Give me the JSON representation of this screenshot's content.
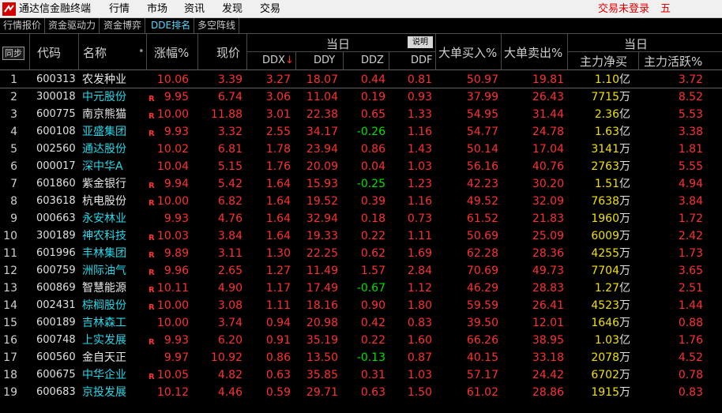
{
  "app": {
    "title": "通达信金融终端",
    "menu": [
      "行情",
      "市场",
      "资讯",
      "发现",
      "交易"
    ],
    "login_status": "交易未登录",
    "extra": "五"
  },
  "tabs": [
    {
      "label": "行情报价",
      "active": false
    },
    {
      "label": "资金驱动力",
      "active": false
    },
    {
      "label": "资金博弈",
      "active": false
    },
    {
      "label": "DDE排名",
      "active": true
    },
    {
      "label": "多空阵线",
      "active": false
    }
  ],
  "header": {
    "sync": "同步",
    "code": "代码",
    "name": "名称",
    "name_marker": "•",
    "change_pct": "涨幅%",
    "price": "现价",
    "group1": "当日",
    "explain": "说明",
    "ddx": "DDX",
    "ddx_sort": "↓",
    "ddy": "DDY",
    "ddz": "DDZ",
    "ddf": "DDF",
    "big_buy": "大单买入%",
    "big_sell": "大单卖出%",
    "group2": "当日",
    "net_buy": "主力净买",
    "active_pct": "主力活跃%"
  },
  "colors": {
    "up": "#ff3030",
    "down": "#00e000",
    "volume": "#f0e000",
    "name_cyan": "#28d7e8"
  },
  "rows": [
    {
      "idx": "1",
      "code": "600313",
      "name": "农发种业",
      "nameColor": "white",
      "r": "",
      "chg": "10.06",
      "price": "3.39",
      "ddx": "3.27",
      "ddy": "18.07",
      "ddz": "0.44",
      "ddzDir": "up",
      "ddf": "0.81",
      "buy": "50.97",
      "sell": "19.81",
      "net": "1.10",
      "netUnit": "亿",
      "active": "3.72"
    },
    {
      "idx": "2",
      "code": "300018",
      "name": "中元股份",
      "nameColor": "cyan",
      "r": "R",
      "chg": "9.95",
      "price": "6.74",
      "ddx": "3.06",
      "ddy": "11.04",
      "ddz": "0.19",
      "ddzDir": "up",
      "ddf": "0.93",
      "buy": "37.99",
      "sell": "26.43",
      "net": "7715",
      "netUnit": "万",
      "active": "8.52"
    },
    {
      "idx": "3",
      "code": "600775",
      "name": "南京熊猫",
      "nameColor": "white",
      "r": "R",
      "chg": "10.00",
      "price": "11.88",
      "ddx": "3.01",
      "ddy": "22.38",
      "ddz": "0.65",
      "ddzDir": "up",
      "ddf": "1.33",
      "buy": "54.95",
      "sell": "31.44",
      "net": "2.36",
      "netUnit": "亿",
      "active": "5.53"
    },
    {
      "idx": "4",
      "code": "600108",
      "name": "亚盛集团",
      "nameColor": "cyan",
      "r": "R",
      "chg": "9.93",
      "price": "3.32",
      "ddx": "2.55",
      "ddy": "34.17",
      "ddz": "-0.26",
      "ddzDir": "down",
      "ddf": "1.16",
      "buy": "54.77",
      "sell": "24.78",
      "net": "1.63",
      "netUnit": "亿",
      "active": "3.38"
    },
    {
      "idx": "5",
      "code": "002560",
      "name": "通达股份",
      "nameColor": "cyan",
      "r": "",
      "chg": "10.02",
      "price": "6.81",
      "ddx": "1.78",
      "ddy": "23.94",
      "ddz": "0.86",
      "ddzDir": "up",
      "ddf": "1.43",
      "buy": "50.14",
      "sell": "17.04",
      "net": "3141",
      "netUnit": "万",
      "active": "1.81"
    },
    {
      "idx": "6",
      "code": "000017",
      "name": "深中华A",
      "nameColor": "cyan",
      "r": "",
      "chg": "10.04",
      "price": "5.15",
      "ddx": "1.76",
      "ddy": "20.09",
      "ddz": "0.04",
      "ddzDir": "up",
      "ddf": "1.03",
      "buy": "56.16",
      "sell": "40.76",
      "net": "2763",
      "netUnit": "万",
      "active": "5.55"
    },
    {
      "idx": "7",
      "code": "601860",
      "name": "紫金银行",
      "nameColor": "white",
      "r": "R",
      "chg": "9.94",
      "price": "5.42",
      "ddx": "1.64",
      "ddy": "15.93",
      "ddz": "-0.25",
      "ddzDir": "down",
      "ddf": "1.23",
      "buy": "42.23",
      "sell": "30.20",
      "net": "1.51",
      "netUnit": "亿",
      "active": "4.94"
    },
    {
      "idx": "8",
      "code": "603618",
      "name": "杭电股份",
      "nameColor": "white",
      "r": "R",
      "chg": "10.00",
      "price": "6.82",
      "ddx": "1.64",
      "ddy": "19.52",
      "ddz": "0.39",
      "ddzDir": "up",
      "ddf": "1.16",
      "buy": "49.52",
      "sell": "32.09",
      "net": "7638",
      "netUnit": "万",
      "active": "3.84"
    },
    {
      "idx": "9",
      "code": "000663",
      "name": "永安林业",
      "nameColor": "cyan",
      "r": "",
      "chg": "9.93",
      "price": "4.76",
      "ddx": "1.64",
      "ddy": "32.94",
      "ddz": "0.18",
      "ddzDir": "up",
      "ddf": "0.73",
      "buy": "61.52",
      "sell": "21.83",
      "net": "1960",
      "netUnit": "万",
      "active": "1.72"
    },
    {
      "idx": "10",
      "code": "300189",
      "name": "神农科技",
      "nameColor": "cyan",
      "r": "R",
      "chg": "10.03",
      "price": "3.84",
      "ddx": "1.64",
      "ddy": "19.33",
      "ddz": "0.22",
      "ddzDir": "up",
      "ddf": "1.11",
      "buy": "50.69",
      "sell": "25.09",
      "net": "6009",
      "netUnit": "万",
      "active": "2.42"
    },
    {
      "idx": "11",
      "code": "601996",
      "name": "丰林集团",
      "nameColor": "cyan",
      "r": "R",
      "chg": "9.89",
      "price": "3.11",
      "ddx": "1.30",
      "ddy": "22.25",
      "ddz": "0.62",
      "ddzDir": "up",
      "ddf": "1.69",
      "buy": "62.28",
      "sell": "28.36",
      "net": "4255",
      "netUnit": "万",
      "active": "1.73"
    },
    {
      "idx": "12",
      "code": "600759",
      "name": "洲际油气",
      "nameColor": "cyan",
      "r": "R",
      "chg": "9.96",
      "price": "2.65",
      "ddx": "1.27",
      "ddy": "11.49",
      "ddz": "1.57",
      "ddzDir": "up",
      "ddf": "2.84",
      "buy": "70.69",
      "sell": "49.73",
      "net": "7704",
      "netUnit": "万",
      "active": "3.65"
    },
    {
      "idx": "13",
      "code": "600869",
      "name": "智慧能源",
      "nameColor": "white",
      "r": "R",
      "chg": "10.11",
      "price": "4.90",
      "ddx": "1.17",
      "ddy": "17.49",
      "ddz": "-0.67",
      "ddzDir": "down",
      "ddf": "1.12",
      "buy": "46.29",
      "sell": "28.83",
      "net": "1.27",
      "netUnit": "亿",
      "active": "2.51"
    },
    {
      "idx": "14",
      "code": "002431",
      "name": "棕榈股份",
      "nameColor": "cyan",
      "r": "R",
      "chg": "10.00",
      "price": "3.08",
      "ddx": "1.11",
      "ddy": "18.16",
      "ddz": "0.90",
      "ddzDir": "up",
      "ddf": "1.80",
      "buy": "59.59",
      "sell": "26.41",
      "net": "4523",
      "netUnit": "万",
      "active": "1.44"
    },
    {
      "idx": "15",
      "code": "600189",
      "name": "吉林森工",
      "nameColor": "cyan",
      "r": "",
      "chg": "10.00",
      "price": "3.74",
      "ddx": "0.94",
      "ddy": "20.98",
      "ddz": "0.42",
      "ddzDir": "up",
      "ddf": "0.83",
      "buy": "39.50",
      "sell": "12.01",
      "net": "1646",
      "netUnit": "万",
      "active": "0.88"
    },
    {
      "idx": "16",
      "code": "600748",
      "name": "上实发展",
      "nameColor": "cyan",
      "r": "R",
      "chg": "9.93",
      "price": "6.20",
      "ddx": "0.91",
      "ddy": "35.19",
      "ddz": "0.22",
      "ddzDir": "up",
      "ddf": "1.60",
      "buy": "66.26",
      "sell": "38.95",
      "net": "1.03",
      "netUnit": "亿",
      "active": "1.76"
    },
    {
      "idx": "17",
      "code": "600560",
      "name": "金自天正",
      "nameColor": "white",
      "r": "",
      "chg": "9.97",
      "price": "10.92",
      "ddx": "0.86",
      "ddy": "13.50",
      "ddz": "-0.13",
      "ddzDir": "down",
      "ddf": "0.87",
      "buy": "40.15",
      "sell": "33.18",
      "net": "2078",
      "netUnit": "万",
      "active": "4.52"
    },
    {
      "idx": "18",
      "code": "600675",
      "name": "中华企业",
      "nameColor": "cyan",
      "r": "R",
      "chg": "10.05",
      "price": "4.82",
      "ddx": "0.63",
      "ddy": "35.85",
      "ddz": "0.31",
      "ddzDir": "up",
      "ddf": "1.03",
      "buy": "57.17",
      "sell": "24.42",
      "net": "6702",
      "netUnit": "万",
      "active": "0.78"
    },
    {
      "idx": "19",
      "code": "600683",
      "name": "京投发展",
      "nameColor": "cyan",
      "r": "",
      "chg": "10.12",
      "price": "4.46",
      "ddx": "0.59",
      "ddy": "29.71",
      "ddz": "0.63",
      "ddzDir": "up",
      "ddf": "1.50",
      "buy": "61.02",
      "sell": "28.86",
      "net": "1915",
      "netUnit": "万",
      "active": "0.83"
    }
  ]
}
